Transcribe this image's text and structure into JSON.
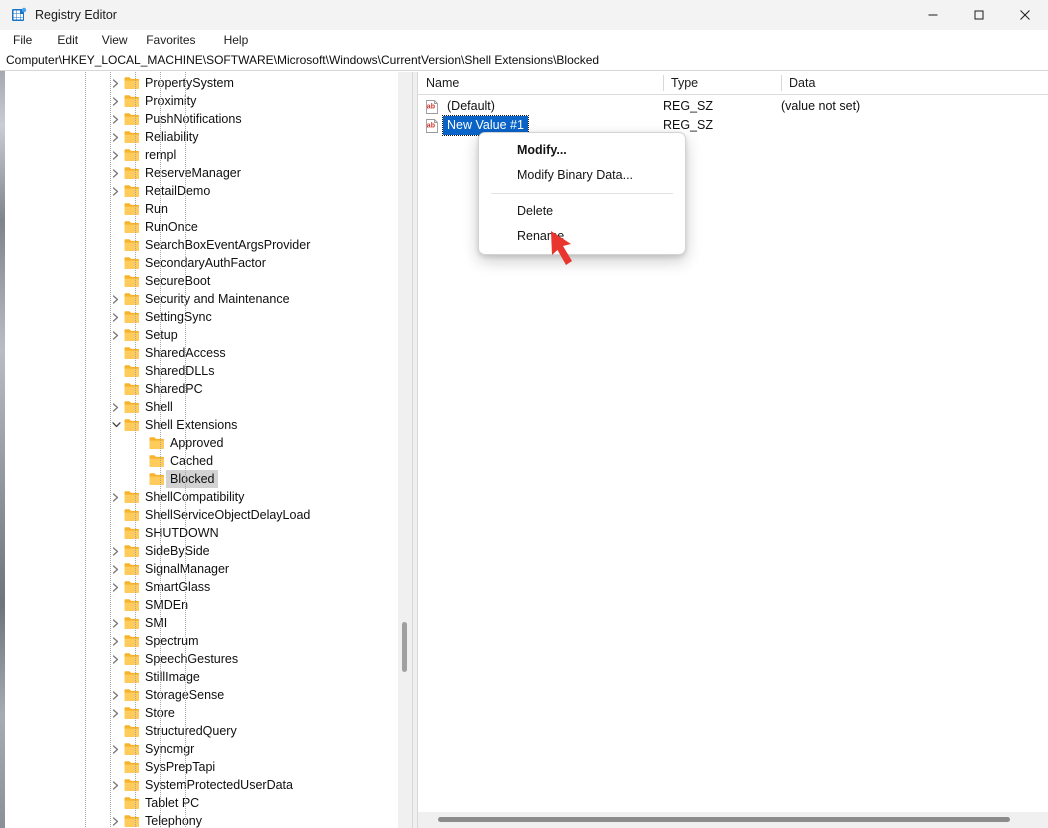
{
  "window": {
    "title": "Registry Editor",
    "icon": "registry-editor-icon",
    "controls": {
      "minimize": "minimize-icon",
      "maximize": "maximize-icon",
      "close": "close-icon"
    }
  },
  "menubar": {
    "items": [
      "File",
      "Edit",
      "View",
      "Favorites",
      "Help"
    ]
  },
  "address_bar": {
    "path": "Computer\\HKEY_LOCAL_MACHINE\\SOFTWARE\\Microsoft\\Windows\\CurrentVersion\\Shell Extensions\\Blocked"
  },
  "tree": {
    "selected": "Blocked",
    "items": [
      {
        "label": "PropertySystem",
        "depth": 0,
        "chevron": "right"
      },
      {
        "label": "Proximity",
        "depth": 0,
        "chevron": "right"
      },
      {
        "label": "PushNotifications",
        "depth": 0,
        "chevron": "right"
      },
      {
        "label": "Reliability",
        "depth": 0,
        "chevron": "right"
      },
      {
        "label": "rempl",
        "depth": 0,
        "chevron": "right"
      },
      {
        "label": "ReserveManager",
        "depth": 0,
        "chevron": "right"
      },
      {
        "label": "RetailDemo",
        "depth": 0,
        "chevron": "right"
      },
      {
        "label": "Run",
        "depth": 0,
        "chevron": "none"
      },
      {
        "label": "RunOnce",
        "depth": 0,
        "chevron": "none"
      },
      {
        "label": "SearchBoxEventArgsProvider",
        "depth": 0,
        "chevron": "none"
      },
      {
        "label": "SecondaryAuthFactor",
        "depth": 0,
        "chevron": "none"
      },
      {
        "label": "SecureBoot",
        "depth": 0,
        "chevron": "none"
      },
      {
        "label": "Security and Maintenance",
        "depth": 0,
        "chevron": "right"
      },
      {
        "label": "SettingSync",
        "depth": 0,
        "chevron": "right"
      },
      {
        "label": "Setup",
        "depth": 0,
        "chevron": "right"
      },
      {
        "label": "SharedAccess",
        "depth": 0,
        "chevron": "none"
      },
      {
        "label": "SharedDLLs",
        "depth": 0,
        "chevron": "none"
      },
      {
        "label": "SharedPC",
        "depth": 0,
        "chevron": "none"
      },
      {
        "label": "Shell",
        "depth": 0,
        "chevron": "right"
      },
      {
        "label": "Shell Extensions",
        "depth": 0,
        "chevron": "down"
      },
      {
        "label": "Approved",
        "depth": 1,
        "chevron": "none"
      },
      {
        "label": "Cached",
        "depth": 1,
        "chevron": "none"
      },
      {
        "label": "Blocked",
        "depth": 1,
        "chevron": "none",
        "selected": true
      },
      {
        "label": "ShellCompatibility",
        "depth": 0,
        "chevron": "right"
      },
      {
        "label": "ShellServiceObjectDelayLoad",
        "depth": 0,
        "chevron": "none"
      },
      {
        "label": "SHUTDOWN",
        "depth": 0,
        "chevron": "none"
      },
      {
        "label": "SideBySide",
        "depth": 0,
        "chevron": "right"
      },
      {
        "label": "SignalManager",
        "depth": 0,
        "chevron": "right"
      },
      {
        "label": "SmartGlass",
        "depth": 0,
        "chevron": "right"
      },
      {
        "label": "SMDEn",
        "depth": 0,
        "chevron": "none"
      },
      {
        "label": "SMI",
        "depth": 0,
        "chevron": "right"
      },
      {
        "label": "Spectrum",
        "depth": 0,
        "chevron": "right"
      },
      {
        "label": "SpeechGestures",
        "depth": 0,
        "chevron": "right"
      },
      {
        "label": "StillImage",
        "depth": 0,
        "chevron": "none"
      },
      {
        "label": "StorageSense",
        "depth": 0,
        "chevron": "right"
      },
      {
        "label": "Store",
        "depth": 0,
        "chevron": "right"
      },
      {
        "label": "StructuredQuery",
        "depth": 0,
        "chevron": "none"
      },
      {
        "label": "Syncmgr",
        "depth": 0,
        "chevron": "right"
      },
      {
        "label": "SysPrepTapi",
        "depth": 0,
        "chevron": "none"
      },
      {
        "label": "SystemProtectedUserData",
        "depth": 0,
        "chevron": "right"
      },
      {
        "label": "Tablet PC",
        "depth": 0,
        "chevron": "none"
      },
      {
        "label": "Telephony",
        "depth": 0,
        "chevron": "right"
      }
    ]
  },
  "list": {
    "columns": [
      "Name",
      "Type",
      "Data"
    ],
    "rows": [
      {
        "name": "(Default)",
        "type": "REG_SZ",
        "data": "(value not set)",
        "icon": "string-value-icon",
        "selected": false
      },
      {
        "name": "New Value #1",
        "type": "REG_SZ",
        "data": "",
        "icon": "string-value-icon",
        "selected": true
      }
    ]
  },
  "context_menu": {
    "items": [
      {
        "label": "Modify...",
        "bold": true,
        "separator_after": false
      },
      {
        "label": "Modify Binary Data...",
        "bold": false,
        "separator_after": true
      },
      {
        "label": "Delete",
        "bold": false,
        "separator_after": false
      },
      {
        "label": "Rename",
        "bold": false,
        "separator_after": false
      }
    ]
  },
  "annotation": {
    "arrow": "red-arrow-pointer",
    "color": "#e8352e",
    "points_to": "Rename"
  },
  "colors": {
    "selection_blue": "#0a64c8",
    "tree_selection_gray": "#d2d2d2",
    "folder_yellow": "#ffc34d",
    "annotation_red": "#e8352e"
  }
}
